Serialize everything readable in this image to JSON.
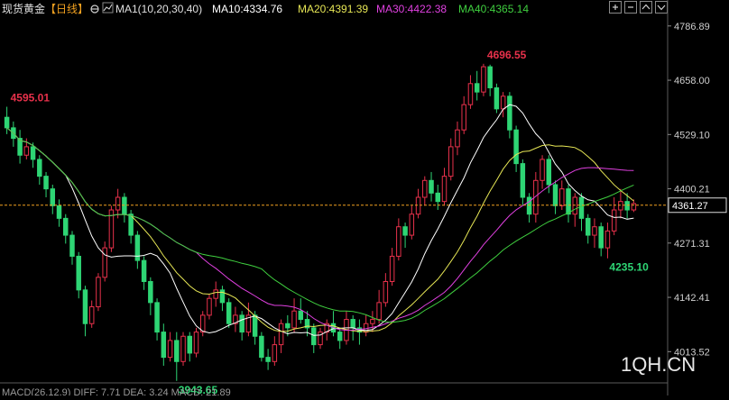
{
  "colors": {
    "up": "#e8314b",
    "down": "#2ed574",
    "ma10": "#ffffff",
    "ma20": "#e6e655",
    "ma30": "#e040e0",
    "ma40": "#3fcf3f",
    "current": "#f0a020",
    "axis_text": "#cfcfcf",
    "background": "#000000"
  },
  "header": {
    "symbol": "现货黄金",
    "period": "【日线】",
    "settings_icon": "gear-icon",
    "indicator_icon": "chart-icon",
    "ma_params": "MA1(10,20,30,40)",
    "ma10": "MA10:4334.76",
    "ma20": "MA20:4391.39",
    "ma30": "MA30:4422.38",
    "ma40": "MA40:4365.14"
  },
  "window_controls": [
    "plus-icon",
    "minus-icon",
    "up-icon",
    "down-icon"
  ],
  "bottom": {
    "macd": "MACD(26,12,9)  DIFF: 7.71  DEA: 3.24  MACD: 21.89"
  },
  "watermark": "1QH.CN",
  "chart_data": {
    "type": "candlestick",
    "ylim": [
      3950,
      4810
    ],
    "y_ticks": [
      "4786.89",
      "4658.00",
      "4529.10",
      "4400.21",
      "4271.31",
      "4142.41",
      "4013.52"
    ],
    "current_price": "4361.27",
    "annotations": [
      {
        "label": "4595.01",
        "value": 4595.01,
        "index": 0,
        "color": "up"
      },
      {
        "label": "4696.55",
        "value": 4696.55,
        "index": 73,
        "color": "up"
      },
      {
        "label": "3943.65",
        "value": 3943.65,
        "index": 26,
        "color": "down"
      },
      {
        "label": "4235.10",
        "value": 4235.1,
        "index": 92,
        "color": "down"
      }
    ],
    "candles": [
      [
        4570,
        4545,
        4595,
        4530
      ],
      [
        4545,
        4520,
        4560,
        4500
      ],
      [
        4520,
        4480,
        4540,
        4460
      ],
      [
        4480,
        4500,
        4520,
        4470
      ],
      [
        4500,
        4470,
        4510,
        4450
      ],
      [
        4470,
        4430,
        4480,
        4410
      ],
      [
        4430,
        4400,
        4440,
        4380
      ],
      [
        4400,
        4360,
        4410,
        4340
      ],
      [
        4360,
        4330,
        4375,
        4310
      ],
      [
        4330,
        4290,
        4340,
        4270
      ],
      [
        4290,
        4240,
        4300,
        4220
      ],
      [
        4240,
        4160,
        4250,
        4140
      ],
      [
        4160,
        4080,
        4170,
        4050
      ],
      [
        4080,
        4120,
        4135,
        4070
      ],
      [
        4120,
        4190,
        4200,
        4110
      ],
      [
        4190,
        4260,
        4275,
        4180
      ],
      [
        4260,
        4350,
        4360,
        4250
      ],
      [
        4350,
        4380,
        4400,
        4330
      ],
      [
        4380,
        4340,
        4390,
        4320
      ],
      [
        4340,
        4290,
        4350,
        4270
      ],
      [
        4290,
        4230,
        4300,
        4210
      ],
      [
        4230,
        4180,
        4240,
        4160
      ],
      [
        4180,
        4130,
        4190,
        4100
      ],
      [
        4130,
        4060,
        4140,
        4040
      ],
      [
        4060,
        4000,
        4080,
        3980
      ],
      [
        4000,
        4040,
        4060,
        3990
      ],
      [
        4040,
        3990,
        4060,
        3944
      ],
      [
        3990,
        4050,
        4060,
        3980
      ],
      [
        4050,
        4010,
        4060,
        3990
      ],
      [
        4010,
        4060,
        4070,
        4000
      ],
      [
        4060,
        4100,
        4110,
        4050
      ],
      [
        4100,
        4140,
        4150,
        4090
      ],
      [
        4140,
        4160,
        4180,
        4120
      ],
      [
        4160,
        4130,
        4170,
        4110
      ],
      [
        4130,
        4080,
        4140,
        4070
      ],
      [
        4080,
        4100,
        4120,
        4060
      ],
      [
        4100,
        4060,
        4110,
        4040
      ],
      [
        4060,
        4100,
        4130,
        4050
      ],
      [
        4100,
        4050,
        4110,
        4030
      ],
      [
        4050,
        4000,
        4060,
        3990
      ],
      [
        4000,
        3990,
        4020,
        3970
      ],
      [
        3990,
        4030,
        4050,
        3980
      ],
      [
        4030,
        4080,
        4090,
        4010
      ],
      [
        4080,
        4070,
        4100,
        4050
      ],
      [
        4070,
        4110,
        4140,
        4060
      ],
      [
        4110,
        4090,
        4140,
        4080
      ],
      [
        4090,
        4070,
        4110,
        4050
      ],
      [
        4070,
        4030,
        4080,
        4010
      ],
      [
        4030,
        4060,
        4070,
        4020
      ],
      [
        4060,
        4080,
        4090,
        4040
      ],
      [
        4080,
        4060,
        4110,
        4050
      ],
      [
        4060,
        4040,
        4070,
        4020
      ],
      [
        4040,
        4090,
        4110,
        4030
      ],
      [
        4090,
        4070,
        4100,
        4040
      ],
      [
        4070,
        4060,
        4090,
        4030
      ],
      [
        4060,
        4080,
        4100,
        4050
      ],
      [
        4080,
        4090,
        4110,
        4060
      ],
      [
        4090,
        4130,
        4160,
        4080
      ],
      [
        4130,
        4180,
        4200,
        4120
      ],
      [
        4180,
        4240,
        4260,
        4170
      ],
      [
        4240,
        4310,
        4330,
        4230
      ],
      [
        4310,
        4290,
        4320,
        4260
      ],
      [
        4290,
        4340,
        4360,
        4280
      ],
      [
        4340,
        4380,
        4400,
        4330
      ],
      [
        4380,
        4420,
        4430,
        4360
      ],
      [
        4420,
        4390,
        4440,
        4370
      ],
      [
        4390,
        4370,
        4410,
        4350
      ],
      [
        4370,
        4430,
        4450,
        4360
      ],
      [
        4430,
        4500,
        4520,
        4420
      ],
      [
        4500,
        4540,
        4560,
        4480
      ],
      [
        4540,
        4600,
        4620,
        4530
      ],
      [
        4600,
        4650,
        4670,
        4590
      ],
      [
        4650,
        4630,
        4680,
        4610
      ],
      [
        4630,
        4690,
        4697,
        4620
      ],
      [
        4690,
        4640,
        4695,
        4620
      ],
      [
        4640,
        4590,
        4650,
        4580
      ],
      [
        4590,
        4620,
        4630,
        4570
      ],
      [
        4620,
        4540,
        4630,
        4520
      ],
      [
        4540,
        4460,
        4550,
        4440
      ],
      [
        4460,
        4380,
        4470,
        4360
      ],
      [
        4380,
        4340,
        4390,
        4320
      ],
      [
        4340,
        4420,
        4440,
        4320
      ],
      [
        4420,
        4470,
        4480,
        4400
      ],
      [
        4470,
        4410,
        4480,
        4390
      ],
      [
        4410,
        4360,
        4420,
        4340
      ],
      [
        4360,
        4400,
        4420,
        4350
      ],
      [
        4400,
        4340,
        4410,
        4320
      ],
      [
        4340,
        4380,
        4390,
        4310
      ],
      [
        4380,
        4330,
        4390,
        4300
      ],
      [
        4330,
        4290,
        4340,
        4270
      ],
      [
        4290,
        4310,
        4330,
        4260
      ],
      [
        4310,
        4260,
        4320,
        4240
      ],
      [
        4260,
        4300,
        4320,
        4235
      ],
      [
        4300,
        4350,
        4380,
        4290
      ],
      [
        4350,
        4370,
        4400,
        4330
      ],
      [
        4370,
        4350,
        4390,
        4330
      ],
      [
        4350,
        4365,
        4375,
        4345
      ]
    ]
  }
}
